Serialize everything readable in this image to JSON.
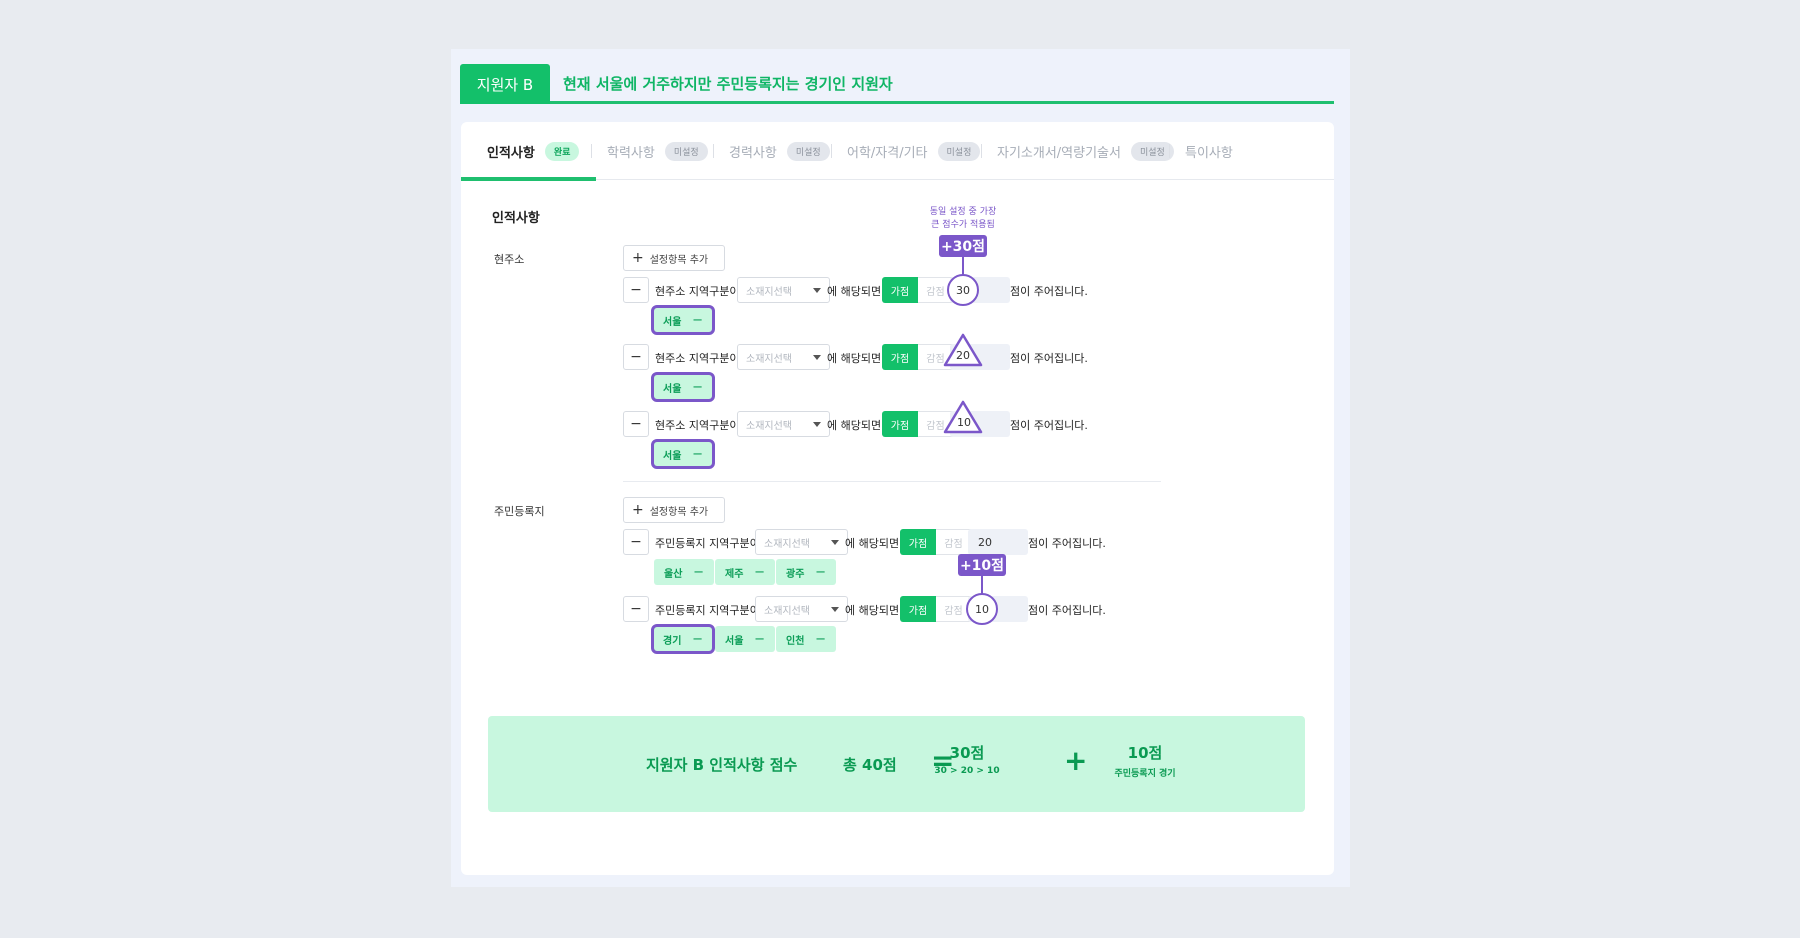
{
  "header": {
    "applicant_badge": "지원자 B",
    "description": "현재 서울에 거주하지만 주민등록지는 경기인 지원자"
  },
  "tabs": [
    {
      "label": "인적사항",
      "status": "완료"
    },
    {
      "label": "학력사항",
      "status": "미설정"
    },
    {
      "label": "경력사항",
      "status": "미설정"
    },
    {
      "label": "어학/자격/기타",
      "status": "미설정"
    },
    {
      "label": "자기소개서/역량기술서",
      "status": "미설정"
    },
    {
      "label": "특이사항"
    }
  ],
  "section_title": "인적사항",
  "add_item_label": "설정항목 추가",
  "common": {
    "region_select_placeholder": "소재지선택",
    "if_match": "에 해당되면",
    "add_points": "가점",
    "deduct_points": "감점",
    "points_given": "점이 주어집니다."
  },
  "current_address": {
    "label": "현주소",
    "condition": "현주소 지역구분이",
    "rules": [
      {
        "score": "30",
        "regions": [
          "서울"
        ]
      },
      {
        "score": "20",
        "regions": [
          "서울"
        ]
      },
      {
        "score": "10",
        "regions": [
          "서울"
        ]
      }
    ]
  },
  "registered_address": {
    "label": "주민등록지",
    "condition": "주민등록지 지역구분이",
    "rules": [
      {
        "score": "20",
        "regions": [
          "울산",
          "제주",
          "광주"
        ]
      },
      {
        "score": "10",
        "regions": [
          "경기",
          "서울",
          "인천"
        ]
      }
    ]
  },
  "annotations": {
    "note_line1": "동일 설정 중 가장",
    "note_line2": "큰 점수가 적용됨",
    "tag_top": "+30점",
    "tag_bottom": "+10점"
  },
  "summary": {
    "title": "지원자 B 인적사항 점수",
    "total": "총 40점",
    "equals": "=",
    "plus": "+",
    "part1_value": "30점",
    "part1_detail": "30 > 20 > 10",
    "part2_value": "10점",
    "part2_detail": "주민등록지 경기"
  },
  "colors": {
    "accent_green": "#13c06a",
    "highlight_purple": "#7b57c9",
    "chip_bg": "#c8f7df"
  }
}
